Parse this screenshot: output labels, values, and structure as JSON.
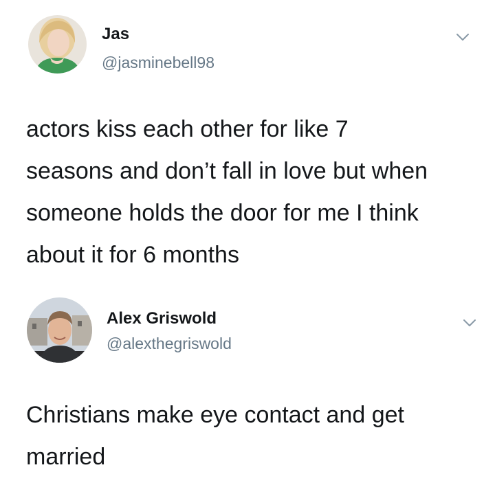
{
  "tweets": [
    {
      "display_name": "Jas",
      "handle": "@jasminebell98",
      "avatar_icon": "profile-photo-icon",
      "menu_icon": "chevron-down-icon",
      "text_lines": [
        "actors kiss each other for like 7",
        "seasons and don’t fall in love but when",
        "someone holds the door for me I think",
        "about it for 6 months"
      ]
    },
    {
      "display_name": "Alex Griswold",
      "handle": "@alexthegriswold",
      "avatar_icon": "profile-photo-icon",
      "menu_icon": "chevron-down-icon",
      "text_lines": [
        "Christians make eye contact and get",
        "married"
      ]
    }
  ],
  "colors": {
    "name": "#14171a",
    "handle": "#657786",
    "chevron": "#8899a6",
    "background": "#ffffff"
  }
}
